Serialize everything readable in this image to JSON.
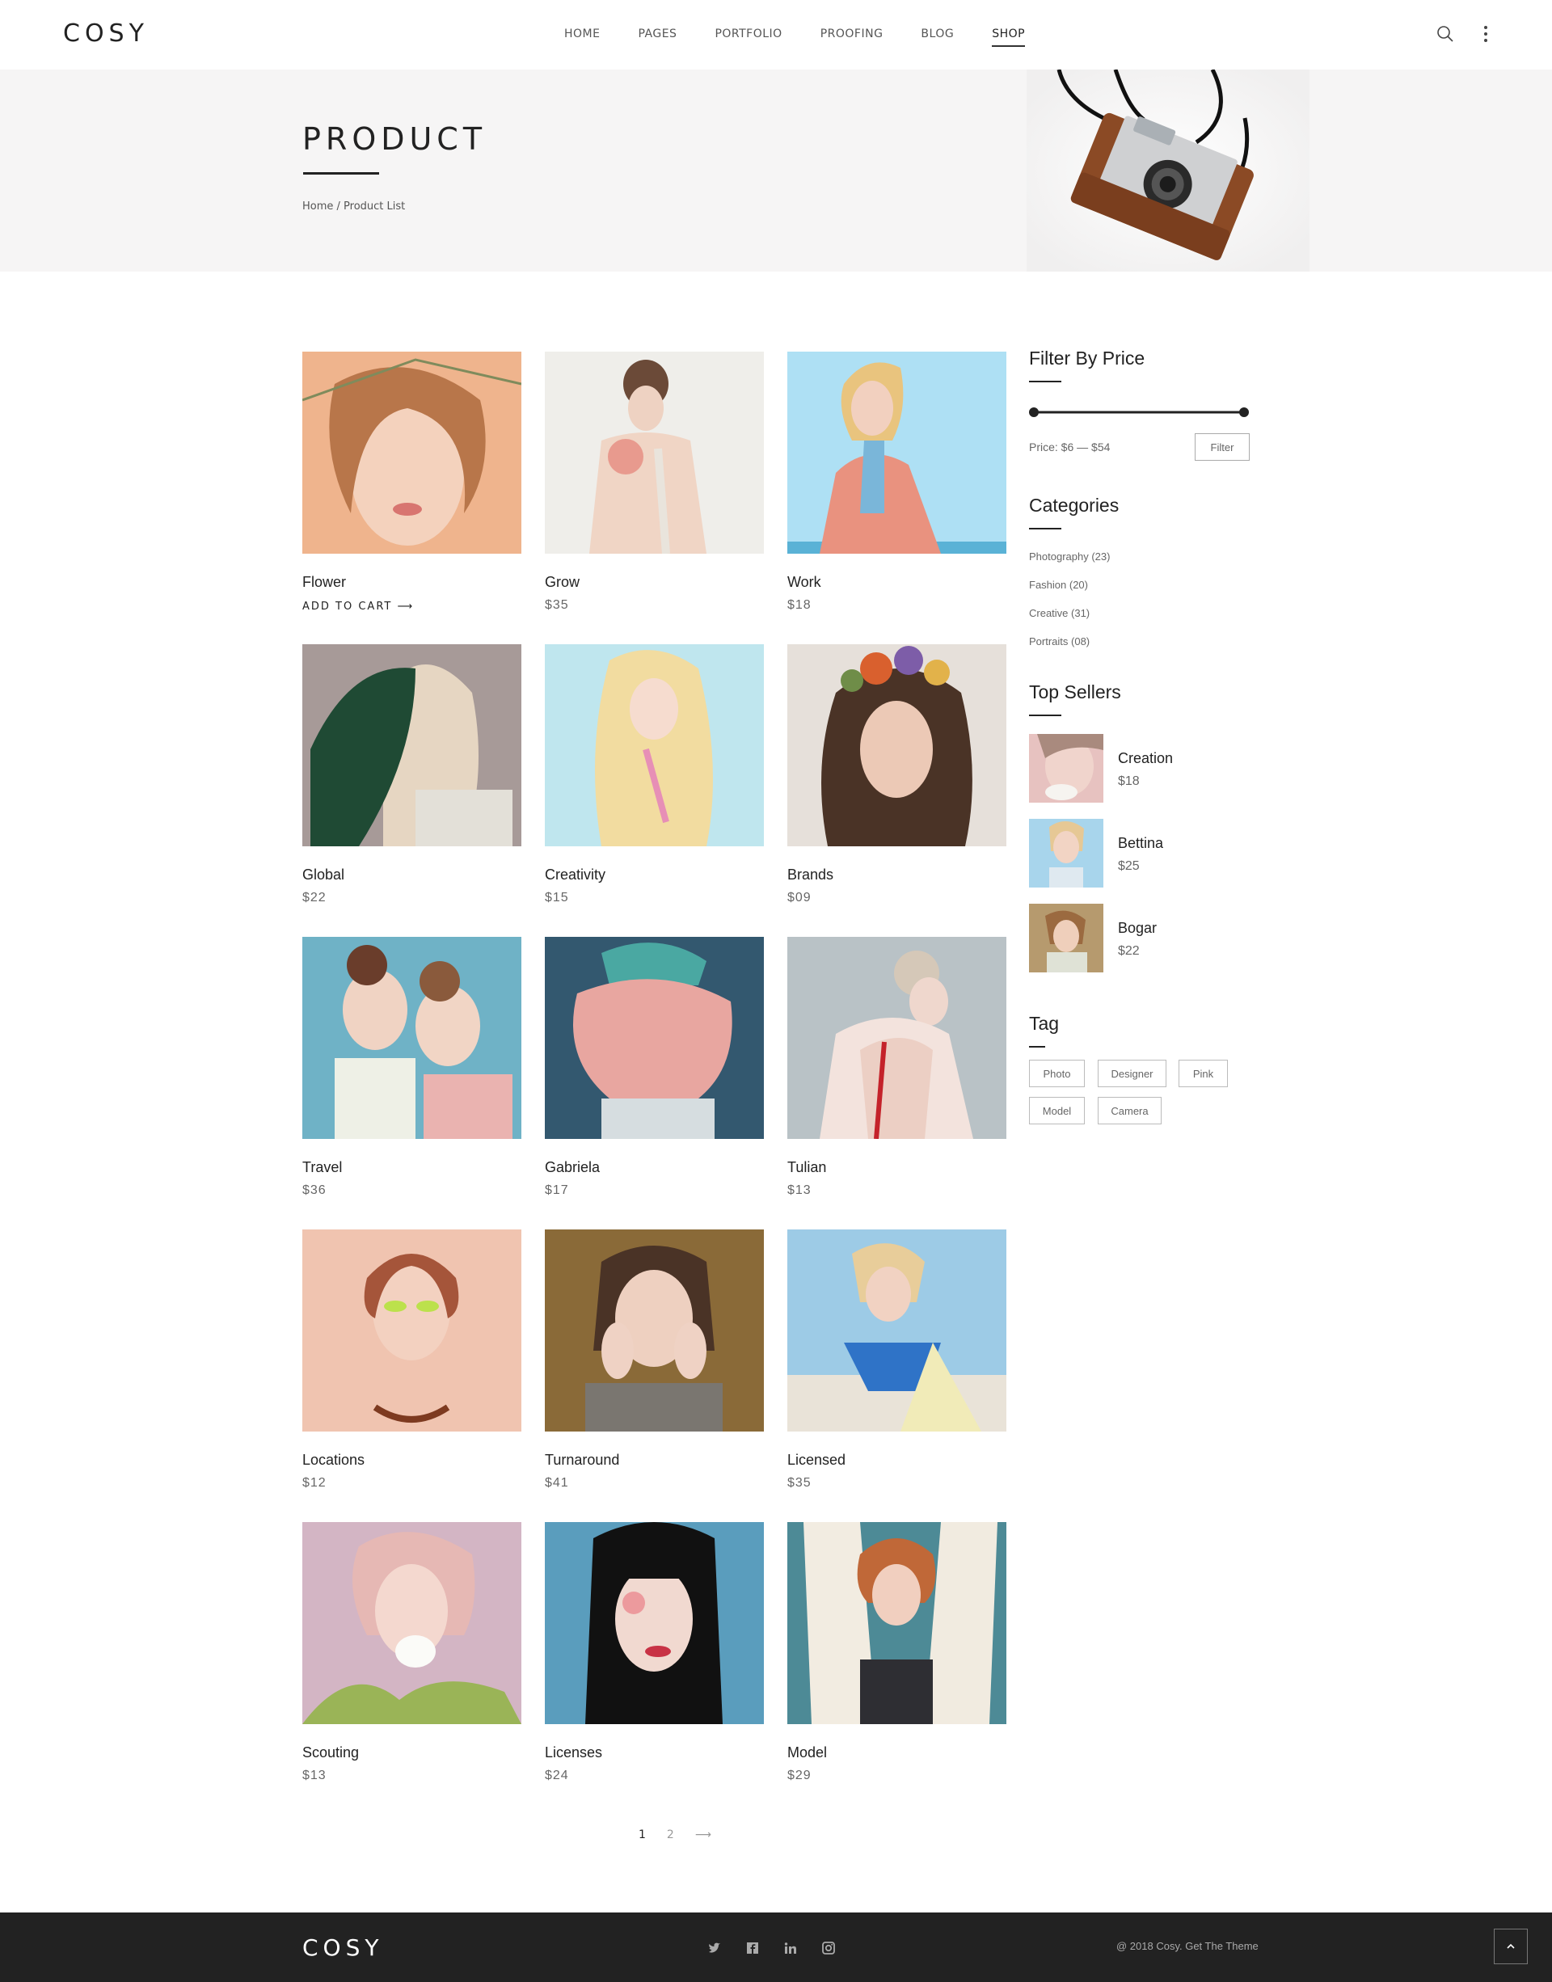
{
  "brand": {
    "logo": "COSY"
  },
  "nav": {
    "items": [
      "HOME",
      "PAGES",
      "PORTFOLIO",
      "PROOFING",
      "BLOG",
      "SHOP"
    ],
    "active": "SHOP"
  },
  "icons": {
    "search": "search-icon",
    "more": "more-vertical-icon"
  },
  "hero": {
    "title": "PRODUCT",
    "breadcrumb": "Home / Product List"
  },
  "products": [
    {
      "name": "Flower",
      "cart_label": "ADD TO CART ⟶"
    },
    {
      "name": "Grow",
      "price": "$35"
    },
    {
      "name": "Work",
      "price": "$18"
    },
    {
      "name": "Global",
      "price": "$22"
    },
    {
      "name": "Creativity",
      "price": "$15"
    },
    {
      "name": "Brands",
      "price": "$09"
    },
    {
      "name": "Travel",
      "price": "$36"
    },
    {
      "name": "Gabriela",
      "price": "$17"
    },
    {
      "name": "Tulian",
      "price": "$13"
    },
    {
      "name": "Locations",
      "price": "$12"
    },
    {
      "name": "Turnaround",
      "price": "$41"
    },
    {
      "name": "Licensed",
      "price": "$35"
    },
    {
      "name": "Scouting",
      "price": "$13"
    },
    {
      "name": "Licenses",
      "price": "$24"
    },
    {
      "name": "Model",
      "price": "$29"
    }
  ],
  "sidebar": {
    "filter": {
      "title": "Filter By Price",
      "price_text": "Price: $6 — $54",
      "button": "Filter"
    },
    "categories": {
      "title": "Categories",
      "items": [
        "Photography (23)",
        "Fashion (20)",
        "Creative (31)",
        "Portraits (08)"
      ]
    },
    "top_sellers": {
      "title": "Top Sellers",
      "items": [
        {
          "name": "Creation",
          "price": "$18"
        },
        {
          "name": "Bettina",
          "price": "$25"
        },
        {
          "name": "Bogar",
          "price": "$22"
        }
      ]
    },
    "tags": {
      "title": "Tag",
      "items": [
        "Photo",
        "Designer",
        "Pink",
        "Model",
        "Camera"
      ]
    }
  },
  "pagination": {
    "pages": [
      "1",
      "2"
    ],
    "current": "1",
    "next": "⟶"
  },
  "footer": {
    "logo": "COSY",
    "copyright": "@ 2018 Cosy. Get The Theme",
    "social": [
      "twitter-icon",
      "facebook-icon",
      "linkedin-icon",
      "instagram-icon"
    ]
  },
  "colors": {
    "text": "#222222",
    "muted": "#666666",
    "hero_bg": "#f6f5f5",
    "footer_bg": "#222222"
  }
}
